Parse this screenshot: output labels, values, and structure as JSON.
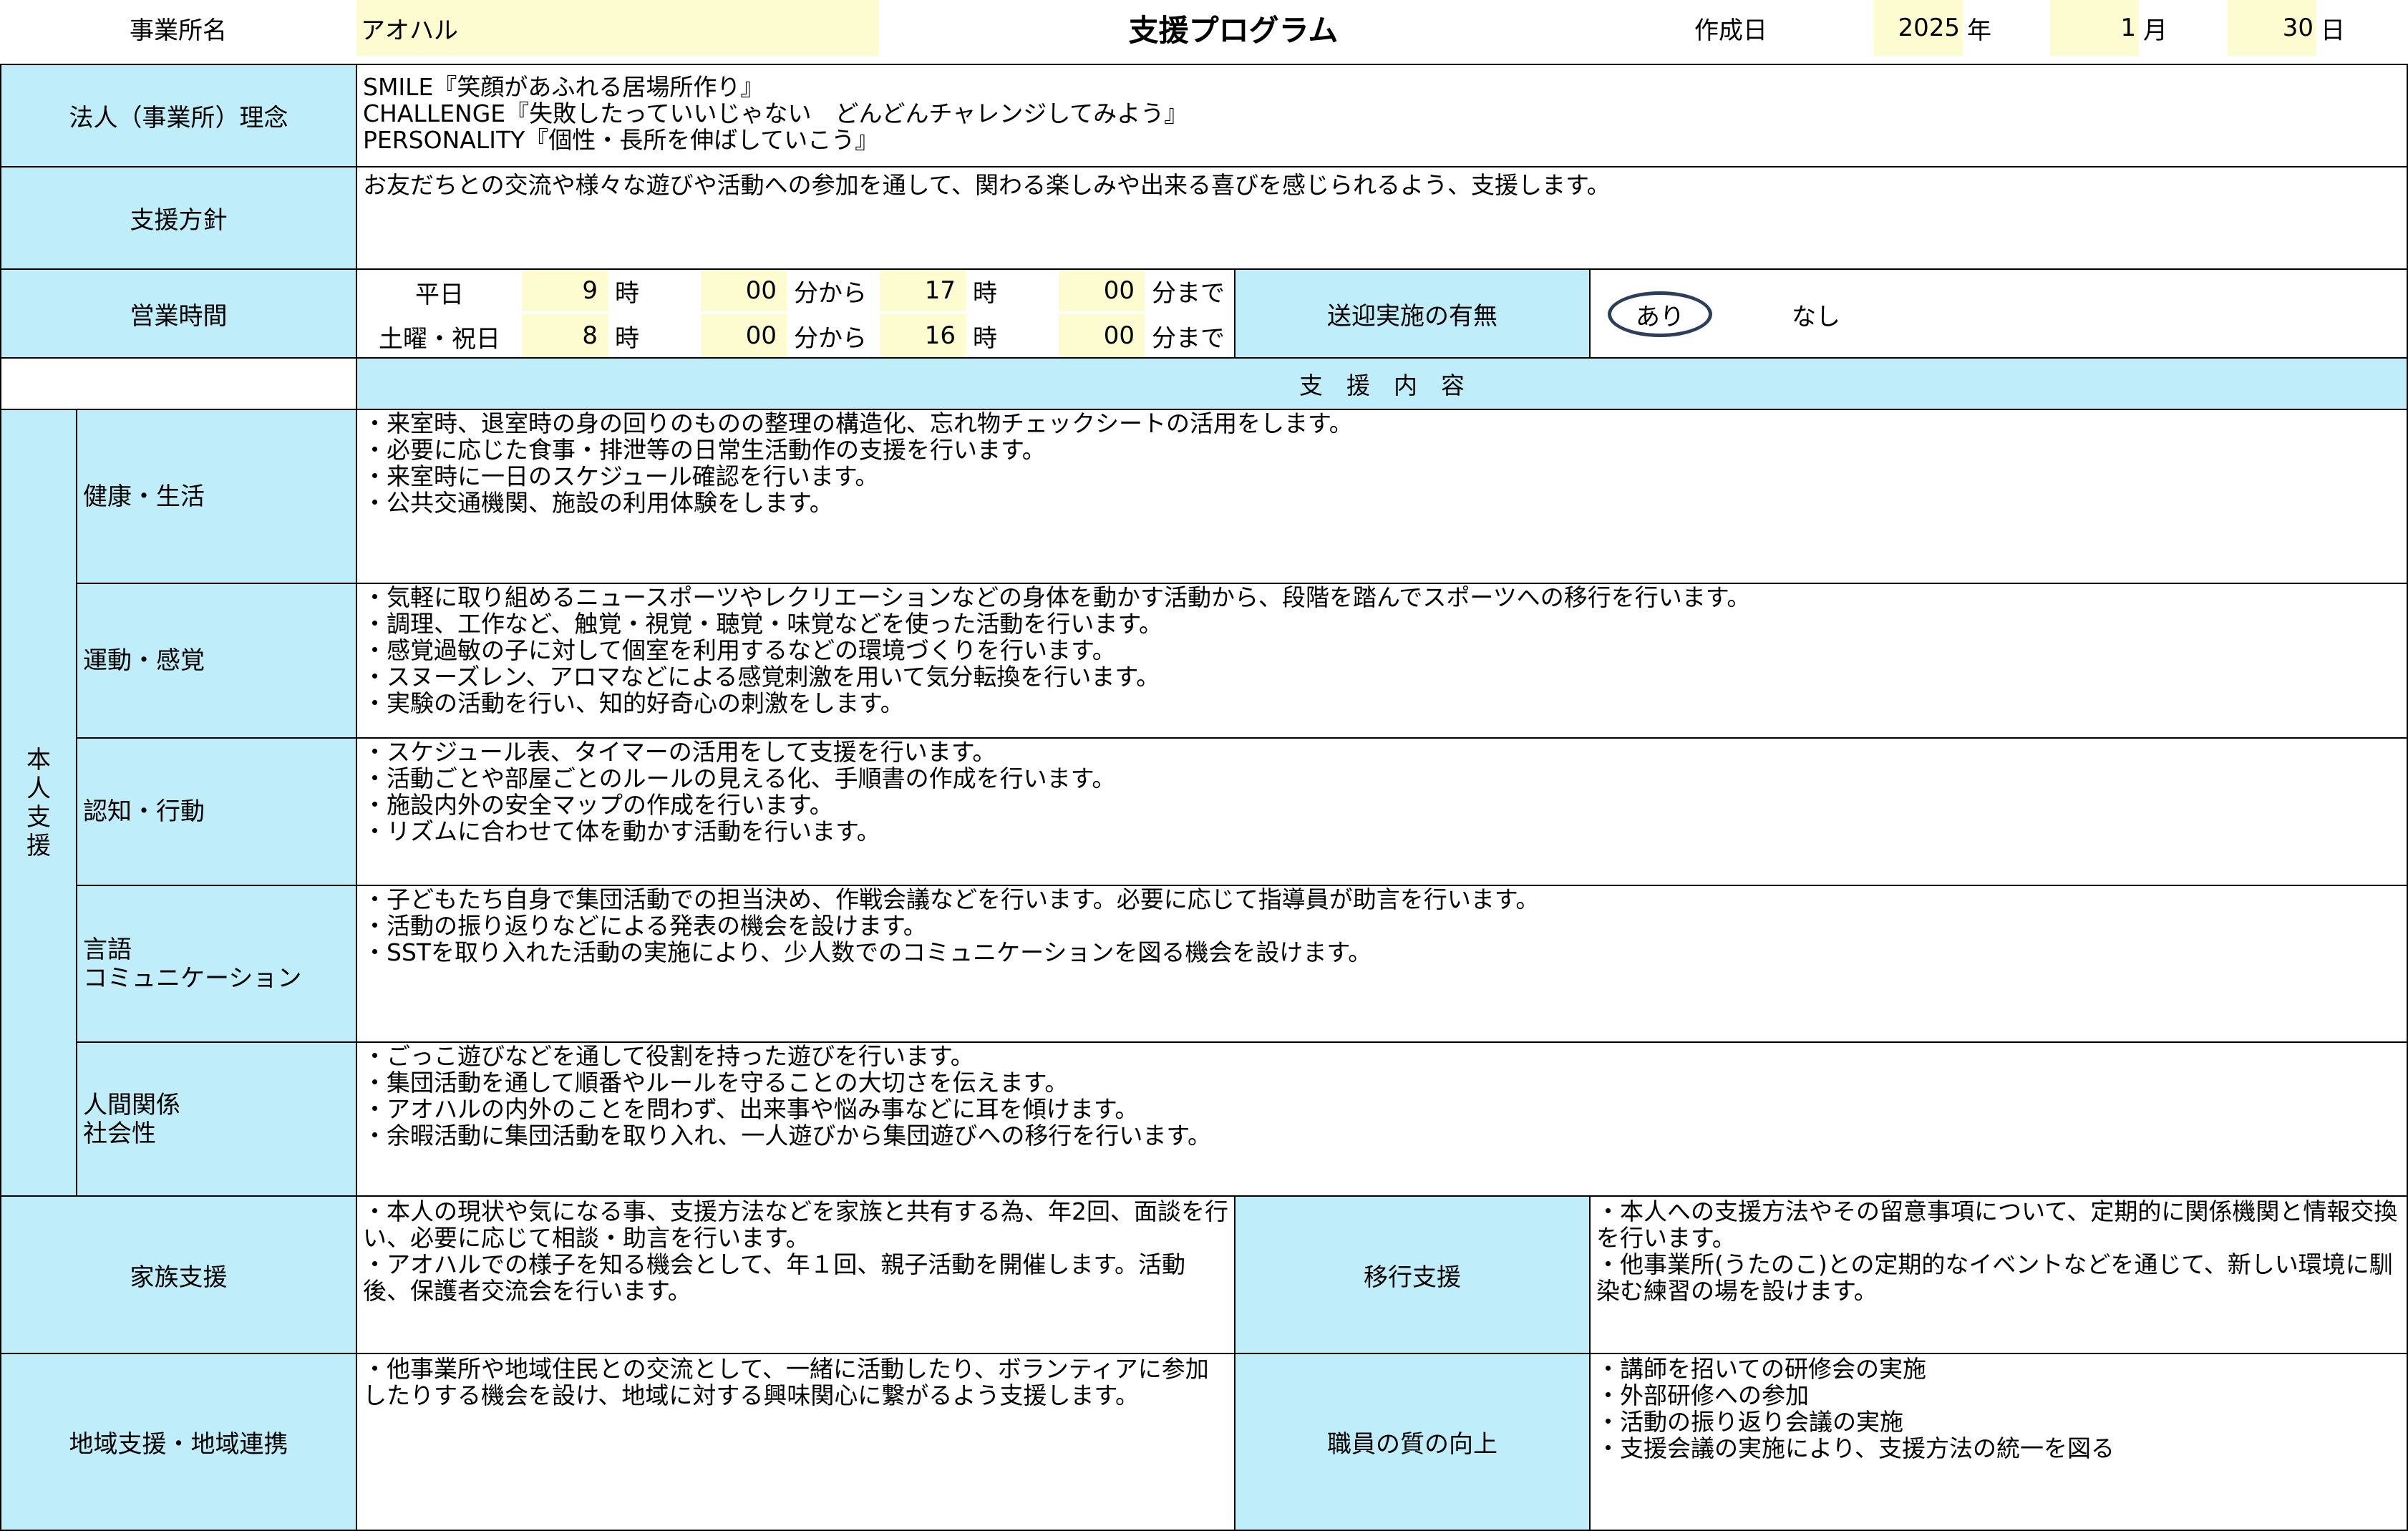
{
  "header": {
    "office_label": "事業所名",
    "office_name": "アオハル",
    "title": "支援プログラム",
    "created_label": "作成日",
    "year": "2025",
    "year_unit": "年",
    "month": "1",
    "month_unit": "月",
    "day": "30",
    "day_unit": "日"
  },
  "philosophy": {
    "label": "法人（事業所）理念",
    "text": "SMILE『笑顔があふれる居場所作り』\nCHALLENGE『失敗したっていいじゃない　どんどんチャレンジしてみよう』\nPERSONALITY『個性・長所を伸ばしていこう』"
  },
  "policy": {
    "label": "支援方針",
    "text": "お友だちとの交流や様々な遊びや活動への参加を通して、関わる楽しみや出来る喜びを感じられるよう、支援します。"
  },
  "hours": {
    "label": "営業時間",
    "weekday_label": "平日",
    "weekday": {
      "start_h": "9",
      "start_m": "00",
      "end_h": "17",
      "end_m": "00"
    },
    "weekend_label": "土曜・祝日",
    "weekend": {
      "start_h": "8",
      "start_m": "00",
      "end_h": "16",
      "end_m": "00"
    },
    "hour_unit": "時",
    "from_unit": "分から",
    "until_unit": "分まで"
  },
  "transport": {
    "label": "送迎実施の有無",
    "yes": "あり",
    "no": "なし",
    "selected": "あり"
  },
  "support_content_label": "支　援　内　容",
  "personal_support": {
    "label": "本\n人\n支\n援",
    "rows": [
      {
        "category": "健康・生活",
        "text": "・来室時、退室時の身の回りのものの整理の構造化、忘れ物チェックシートの活用をします。\n・必要に応じた食事・排泄等の日常生活動作の支援を行います。\n・来室時に一日のスケジュール確認を行います。\n・公共交通機関、施設の利用体験をします。"
      },
      {
        "category": "運動・感覚",
        "text": "・気軽に取り組めるニュースポーツやレクリエーションなどの身体を動かす活動から、段階を踏んでスポーツへの移行を行います。\n・調理、工作など、触覚・視覚・聴覚・味覚などを使った活動を行います。\n・感覚過敏の子に対して個室を利用するなどの環境づくりを行います。\n・スヌーズレン、アロマなどによる感覚刺激を用いて気分転換を行います。\n・実験の活動を行い、知的好奇心の刺激をします。"
      },
      {
        "category": "認知・行動",
        "text": "・スケジュール表、タイマーの活用をして支援を行います。\n・活動ごとや部屋ごとのルールの見える化、手順書の作成を行います。\n・施設内外の安全マップの作成を行います。\n・リズムに合わせて体を動かす活動を行います。"
      },
      {
        "category": "言語\nコミュニケーション",
        "text": "・子どもたち自身で集団活動での担当決め、作戦会議などを行います。必要に応じて指導員が助言を行います。\n・活動の振り返りなどによる発表の機会を設けます。\n・SSTを取り入れた活動の実施により、少人数でのコミュニケーションを図る機会を設けます。"
      },
      {
        "category": "人間関係\n社会性",
        "text": "・ごっこ遊びなどを通して役割を持った遊びを行います。\n・集団活動を通して順番やルールを守ることの大切さを伝えます。\n・アオハルの内外のことを問わず、出来事や悩み事などに耳を傾けます。\n・余暇活動に集団活動を取り入れ、一人遊びから集団遊びへの移行を行います。"
      }
    ]
  },
  "family_support": {
    "label": "家族支援",
    "text": "・本人の現状や気になる事、支援方法などを家族と共有する為、年2回、面談を行い、必要に応じて相談・助言を行います。\n・アオハルでの様子を知る機会として、年１回、親子活動を開催します。活動後、保護者交流会を行います。"
  },
  "transition_support": {
    "label": "移行支援",
    "text": "・本人への支援方法やその留意事項について、定期的に関係機関と情報交換を行います。\n・他事業所(うたのこ)との定期的なイベントなどを通じて、新しい環境に馴染む練習の場を設けます。"
  },
  "community_support": {
    "label": "地域支援・地域連携",
    "text": "・他事業所や地域住民との交流として、一緒に活動したり、ボランティアに参加したりする機会を設け、地域に対する興味関心に繋がるよう支援します。"
  },
  "staff_quality": {
    "label": "職員の質の向上",
    "text": "・講師を招いての研修会の実施\n・外部研修への参加\n・活動の振り返り会議の実施\n・支援会議の実施により、支援方法の統一を図る"
  }
}
